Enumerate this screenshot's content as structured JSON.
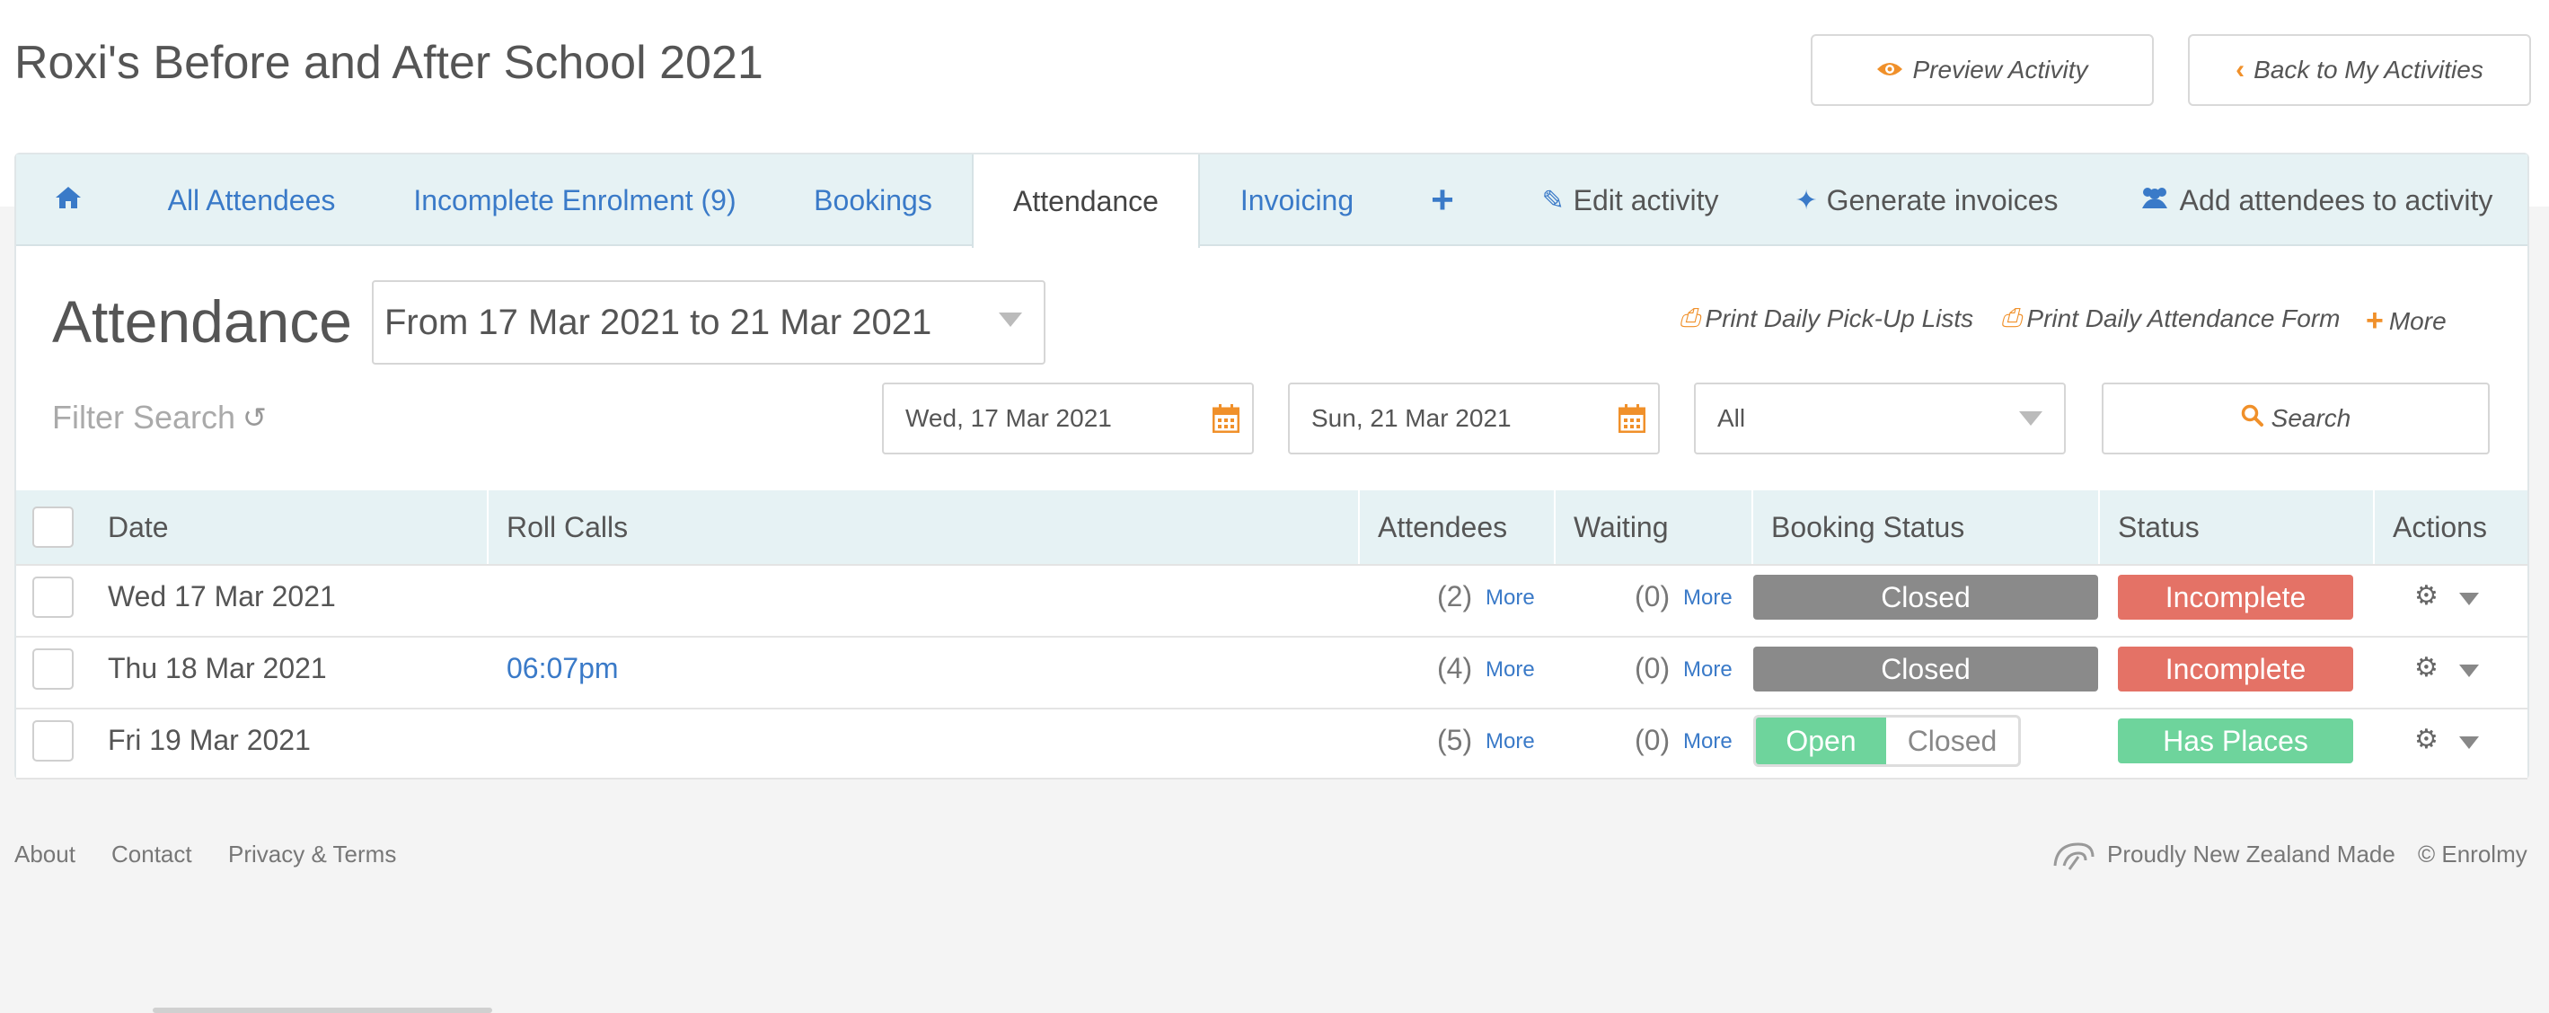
{
  "header": {
    "title": "Roxi's Before and After School 2021",
    "preview_label": "Preview Activity",
    "back_label": "Back to My Activities"
  },
  "tabs": {
    "home_icon": "home-icon",
    "all_attendees": "All Attendees",
    "incomplete": "Incomplete Enrolment (9)",
    "bookings": "Bookings",
    "attendance": "Attendance",
    "invoicing": "Invoicing",
    "edit": "Edit activity",
    "generate": "Generate invoices",
    "add": "Add attendees to activity"
  },
  "attendance": {
    "title": "Attendance",
    "range": "From 17 Mar 2021 to 21 Mar 2021",
    "print_pickup": "Print Daily Pick-Up Lists",
    "print_form": "Print Daily Attendance Form",
    "more": "More"
  },
  "filters": {
    "label": "Filter Search",
    "start_date": "Wed, 17 Mar 2021",
    "end_date": "Sun, 21 Mar 2021",
    "status": "All",
    "search_label": "Search"
  },
  "table": {
    "headers": {
      "date": "Date",
      "roll_calls": "Roll Calls",
      "attendees": "Attendees",
      "waiting": "Waiting",
      "booking_status": "Booking Status",
      "status": "Status",
      "actions": "Actions"
    },
    "rows": [
      {
        "date": "Wed 17 Mar 2021",
        "roll_call": "",
        "attendees": "(2)",
        "waiting": "(0)",
        "more": "More",
        "booking": "Closed",
        "status": "Incomplete"
      },
      {
        "date": "Thu 18 Mar 2021",
        "roll_call": "06:07pm",
        "attendees": "(4)",
        "waiting": "(0)",
        "more": "More",
        "booking": "Closed",
        "status": "Incomplete"
      },
      {
        "date": "Fri 19 Mar 2021",
        "roll_call": "",
        "attendees": "(5)",
        "waiting": "(0)",
        "more": "More",
        "booking_open": "Open",
        "booking_closed": "Closed",
        "status": "Has Places"
      }
    ]
  },
  "footer": {
    "about": "About",
    "contact": "Contact",
    "privacy": "Privacy & Terms",
    "made": "Proudly New Zealand Made",
    "copyright": "© Enrolmy"
  },
  "colors": {
    "accent": "#f0902a",
    "link": "#3a7ac8",
    "closed": "#8a8a8a",
    "incomplete": "#e47266",
    "open": "#6ed49c"
  }
}
